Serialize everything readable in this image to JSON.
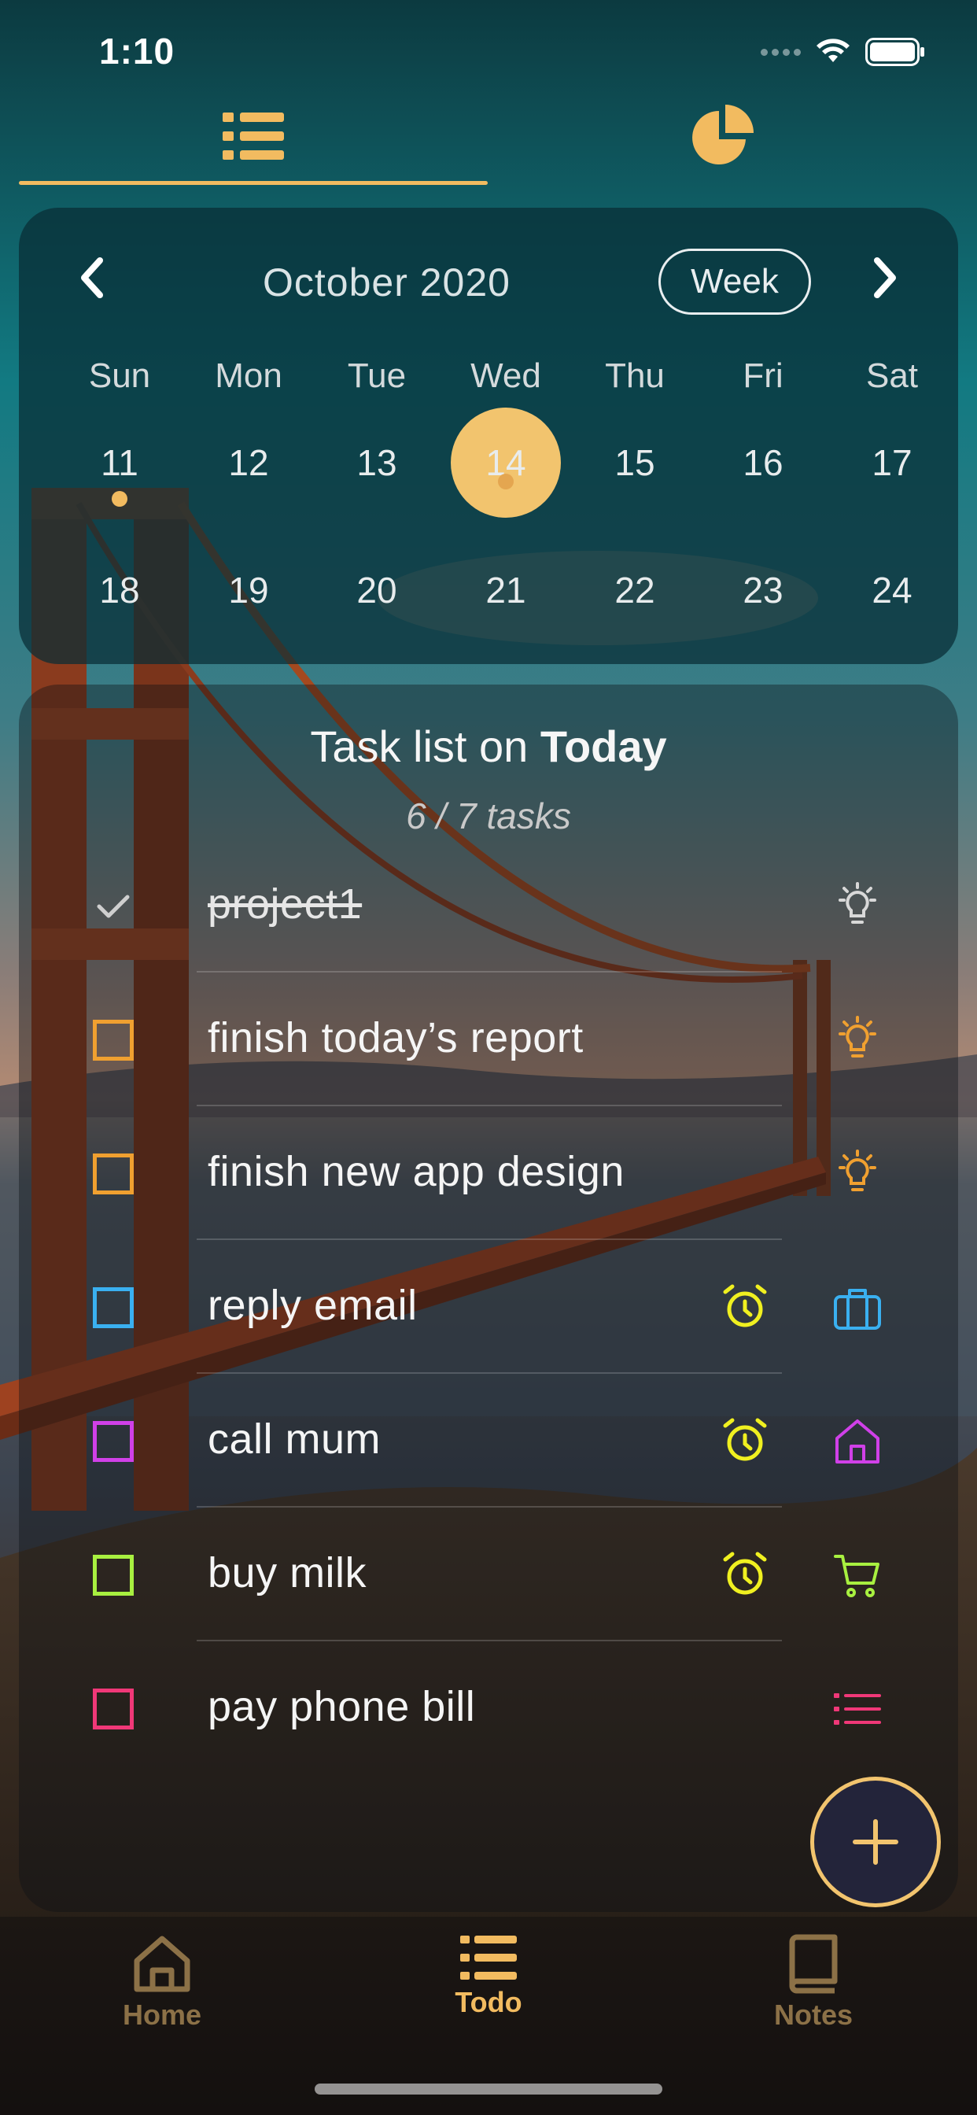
{
  "status_bar": {
    "time": "1:10"
  },
  "top_tabs": [
    {
      "icon": "list-icon",
      "active": true
    },
    {
      "icon": "pie-chart-icon",
      "active": false
    }
  ],
  "calendar": {
    "month_label": "October 2020",
    "view_button": "Week",
    "day_names": [
      "Sun",
      "Mon",
      "Tue",
      "Wed",
      "Thu",
      "Fri",
      "Sat"
    ],
    "weeks": [
      [
        "11",
        "12",
        "13",
        "14",
        "15",
        "16",
        "17"
      ],
      [
        "18",
        "19",
        "20",
        "21",
        "22",
        "23",
        "24"
      ]
    ],
    "selected_date": "14",
    "dot_dates": [
      "11",
      "14"
    ]
  },
  "tasks": {
    "title_prefix": "Task list on",
    "title_day": "Today",
    "count": "6 / 7 tasks",
    "items": [
      {
        "label": "project1",
        "done": true,
        "color": "#cfcfcf",
        "alarm": false,
        "category_icon": "lightbulb-icon",
        "category_color": "#d8d8d8"
      },
      {
        "label": "finish today’s report",
        "done": false,
        "color": "#f0a030",
        "alarm": false,
        "category_icon": "lightbulb-icon",
        "category_color": "#f0a030"
      },
      {
        "label": "finish new app design",
        "done": false,
        "color": "#f0a030",
        "alarm": false,
        "category_icon": "lightbulb-icon",
        "category_color": "#f0a030"
      },
      {
        "label": "reply email",
        "done": false,
        "color": "#3ab0f0",
        "alarm": true,
        "category_icon": "briefcase-icon",
        "category_color": "#3ab0f0"
      },
      {
        "label": "call mum",
        "done": false,
        "color": "#d040e8",
        "alarm": true,
        "category_icon": "house-icon",
        "category_color": "#d040e8"
      },
      {
        "label": "buy milk",
        "done": false,
        "color": "#a8f040",
        "alarm": true,
        "category_icon": "cart-icon",
        "category_color": "#a8f040"
      },
      {
        "label": "pay phone bill",
        "done": false,
        "color": "#f03878",
        "alarm": false,
        "category_icon": "list-icon",
        "category_color": "#f03878"
      }
    ],
    "alarm_color": "#f0f020"
  },
  "bottom_nav": [
    {
      "label": "Home",
      "icon": "house-icon"
    },
    {
      "label": "Todo",
      "icon": "list-icon",
      "active": true
    },
    {
      "label": "Notes",
      "icon": "book-icon"
    }
  ],
  "colors": {
    "accent": "#f2bb60",
    "fab_bg": "#23243a"
  }
}
